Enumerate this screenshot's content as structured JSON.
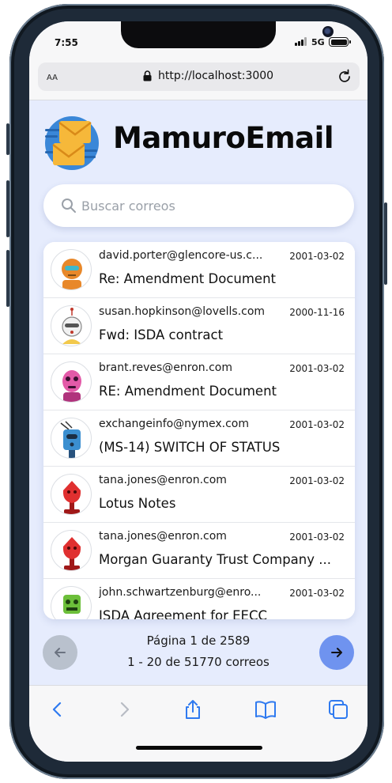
{
  "status_bar": {
    "time": "7:55",
    "network": "5G"
  },
  "browser": {
    "text_size_label": "AA",
    "url": "http://localhost:3000"
  },
  "app": {
    "name": "MamuroEmail"
  },
  "search": {
    "placeholder": "Buscar correos"
  },
  "emails": [
    {
      "from": "david.porter@glencore-us.c...",
      "date": "2001-03-02",
      "subject": "Re: Amendment Document",
      "avatar_color": "#e8882a"
    },
    {
      "from": "susan.hopkinson@lovells.com",
      "date": "2000-11-16",
      "subject": "Fwd: ISDA contract",
      "avatar_color": "#d8d8d8"
    },
    {
      "from": "brant.reves@enron.com",
      "date": "2001-03-02",
      "subject": "RE: Amendment Document",
      "avatar_color": "#e35aa8"
    },
    {
      "from": "exchangeinfo@nymex.com",
      "date": "2001-03-02",
      "subject": "(MS-14) SWITCH OF STATUS",
      "avatar_color": "#3b8fd0"
    },
    {
      "from": "tana.jones@enron.com",
      "date": "2001-03-02",
      "subject": "Lotus Notes",
      "avatar_color": "#e03030"
    },
    {
      "from": "tana.jones@enron.com",
      "date": "2001-03-02",
      "subject": "Morgan Guaranty Trust Company ...",
      "avatar_color": "#e03030"
    },
    {
      "from": "john.schwartzenburg@enro...",
      "date": "2001-03-02",
      "subject": "ISDA Agreement for EECC",
      "avatar_color": "#6cbf3a"
    }
  ],
  "pagination": {
    "page_label": "Página 1 de 2589",
    "range_label": "1 - 20 de 51770 correos"
  },
  "colors": {
    "background": "#e6ecfd",
    "next_button": "#6f93ef",
    "prev_button": "#b9c1cd"
  }
}
